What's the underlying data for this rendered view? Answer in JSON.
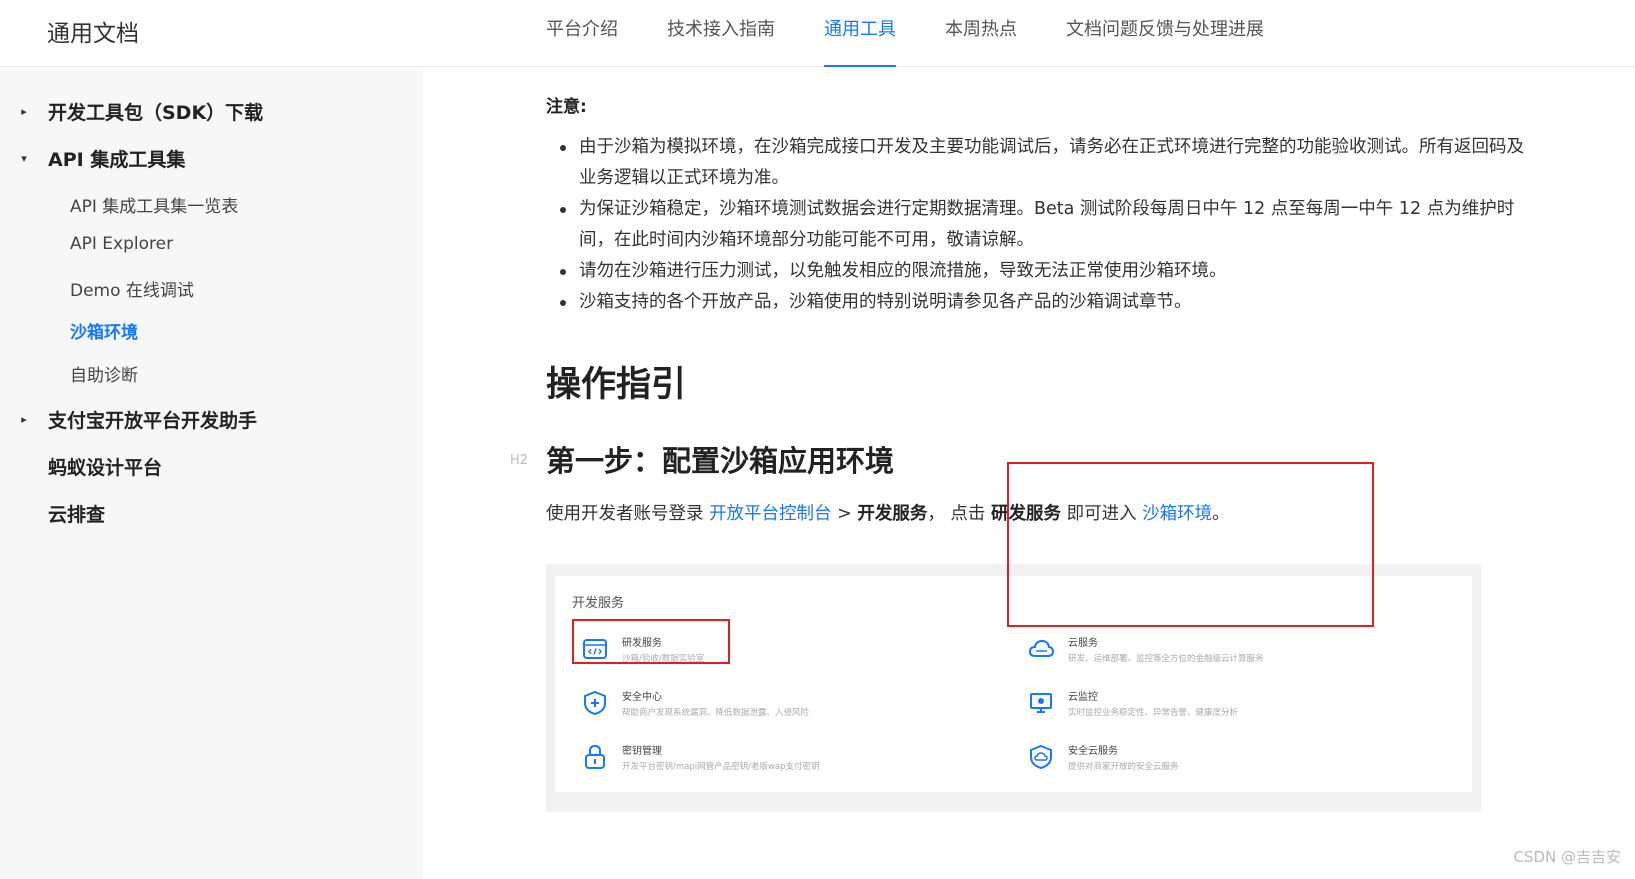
{
  "header": {
    "brand": "通用文档",
    "nav": [
      "平台介绍",
      "技术接入指南",
      "通用工具",
      "本周热点",
      "文档问题反馈与处理进展"
    ]
  },
  "sidebar": {
    "items": [
      {
        "label": "开发工具包（SDK）下载",
        "arrow": "▸"
      },
      {
        "label": "API 集成工具集",
        "arrow": "▾"
      },
      {
        "label": "支付宝开放平台开发助手",
        "arrow": "▸"
      },
      {
        "label": "蚂蚁设计平台",
        "arrow": ""
      },
      {
        "label": "云排查",
        "arrow": ""
      }
    ],
    "sub_items": [
      "API 集成工具集一览表",
      "API Explorer",
      "Demo 在线调试",
      "沙箱环境",
      "自助诊断"
    ]
  },
  "main": {
    "note_title": "注意:",
    "bullets": [
      "由于沙箱为模拟环境，在沙箱完成接口开发及主要功能调试后，请务必在正式环境进行完整的功能验收测试。所有返回码及业务逻辑以正式环境为准。",
      "为保证沙箱稳定，沙箱环境测试数据会进行定期数据清理。Beta 测试阶段每周日中午 12 点至每周一中午 12 点为维护时间，在此时间内沙箱环境部分功能可能不可用，敬请谅解。",
      "请勿在沙箱进行压力测试，以免触发相应的限流措施，导致无法正常使用沙箱环境。",
      "沙箱支持的各个开放产品，沙箱使用的特别说明请参见各产品的沙箱调试章节。"
    ],
    "h1": "操作指引",
    "h2_tag": "H2",
    "h2": "第一步：配置沙箱应用环境",
    "para": {
      "t1": "使用开发者账号登录 ",
      "link1": "开放平台控制台",
      "t2": " > ",
      "b1": "开发服务",
      "t3": "， 点击 ",
      "b2": "研发服务",
      "t4": " 即可进入 ",
      "link2": "沙箱环境",
      "t5": "。"
    }
  },
  "screenshot": {
    "title": "开发服务",
    "services": [
      {
        "name": "研发服务",
        "desc": "沙箱/验收/数据实验室",
        "icon": "code-icon"
      },
      {
        "name": "云服务",
        "desc": "研发、运维部署、监控等全方位的金融级云计算服务",
        "icon": "cloud-icon"
      },
      {
        "name": "安全中心",
        "desc": "帮助商户发现系统漏洞、降低数据泄露、入侵风险",
        "icon": "shield-plus-icon"
      },
      {
        "name": "云监控",
        "desc": "实时监控业务稳定性、异常告警、健康度分析",
        "icon": "monitor-icon"
      },
      {
        "name": "密钥管理",
        "desc": "开发平台密钥/mapi网管产品密钥/老版wap支付密钥",
        "icon": "lock-icon"
      },
      {
        "name": "安全云服务",
        "desc": "提供对商家开放的安全云服务",
        "icon": "shield-cloud-icon"
      }
    ]
  },
  "watermark": "CSDN @吉吉安"
}
